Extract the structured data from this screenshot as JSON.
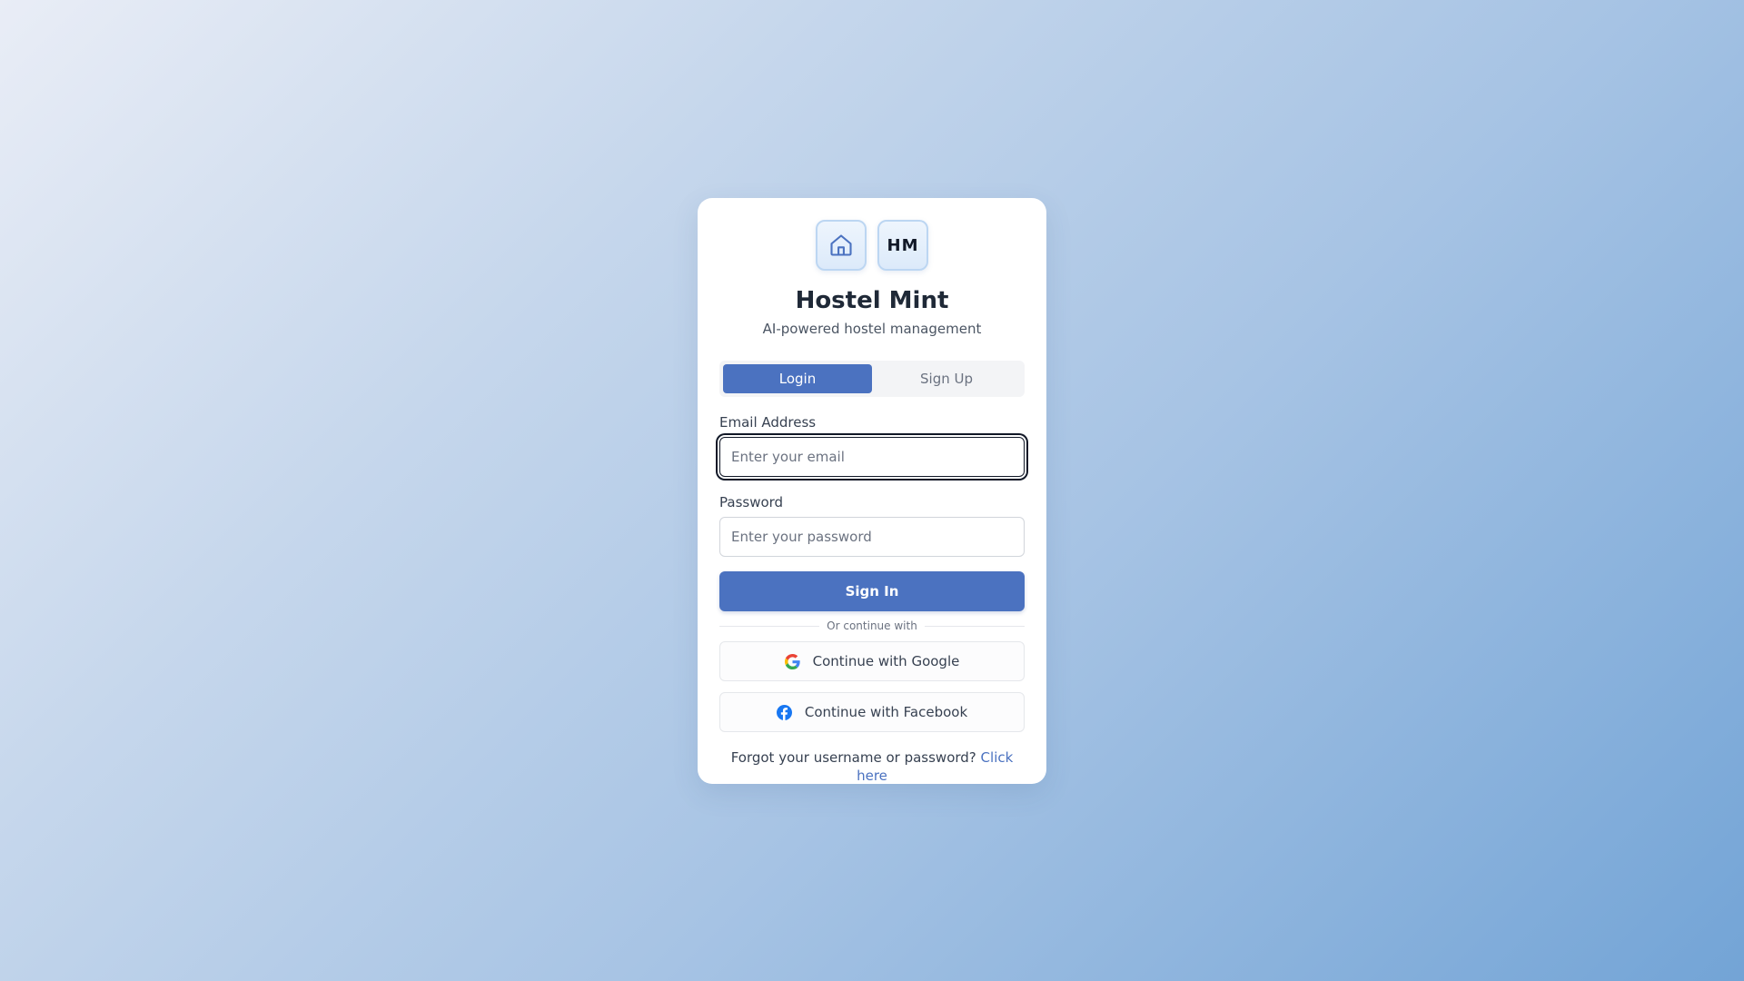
{
  "brand": {
    "logo_icon": "house-icon",
    "logo_initials": "HM",
    "title": "Hostel Mint",
    "subtitle": "AI-powered hostel management"
  },
  "tabs": [
    {
      "label": "Login",
      "active": true
    },
    {
      "label": "Sign Up",
      "active": false
    }
  ],
  "form": {
    "email": {
      "label": "Email Address",
      "placeholder": "Enter your email",
      "value": ""
    },
    "password": {
      "label": "Password",
      "placeholder": "Enter your password",
      "value": ""
    },
    "submit_label": "Sign In"
  },
  "social": {
    "divider_text": "Or continue with",
    "google_label": "Continue with Google",
    "google_icon": "google-icon",
    "facebook_label": "Continue with Facebook",
    "facebook_icon": "facebook-icon"
  },
  "footer": {
    "forgot_text": "Forgot your username or password?",
    "forgot_link": "Click here"
  },
  "colors": {
    "primary": "#4b72c0",
    "google_blue": "#4285F4",
    "google_red": "#EA4335",
    "google_yellow": "#FBBC05",
    "google_green": "#34A853",
    "facebook_blue": "#1877F2"
  }
}
